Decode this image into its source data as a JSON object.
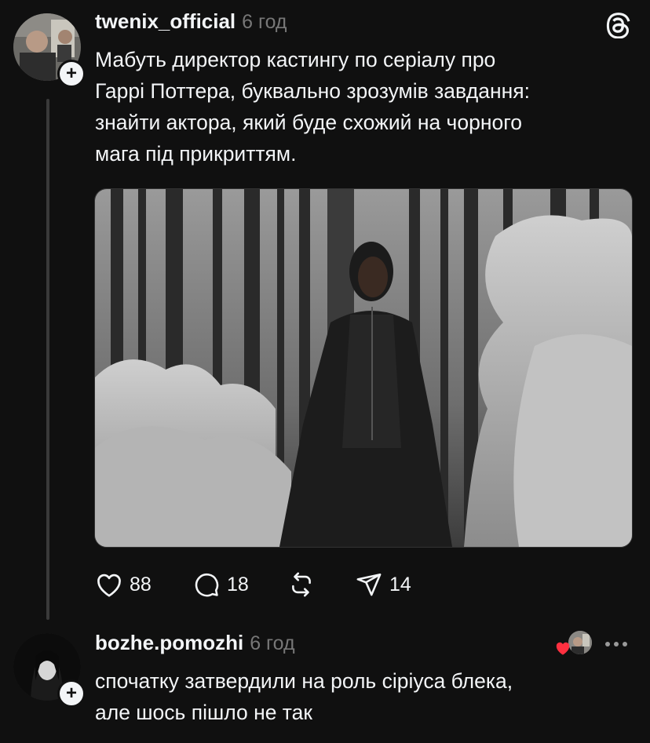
{
  "post": {
    "username": "twenix_official",
    "time": "6 год",
    "text_lines": [
      "Мабуть директор кастингу по серіалу про",
      "Гаррі Поттера, буквально зрозумів завдання:",
      "знайти актора, який буде схожий на чорного",
      "мага під прикриттям."
    ],
    "likes": "88",
    "comments": "18",
    "shares": "14"
  },
  "reply": {
    "username": "bozhe.pomozhi",
    "time": "6 год",
    "text_lines": [
      "спочатку затвердили на роль сіріуса блека,",
      "але шось пішло не так"
    ]
  },
  "icons": {
    "logo": "threads-logo-icon",
    "like": "heart-icon",
    "comment": "comment-icon",
    "repost": "repost-icon",
    "share": "send-icon",
    "more": "more-icon"
  },
  "colors": {
    "background": "#101010",
    "text": "#f3f5f7",
    "secondary": "#777777",
    "liked_heart": "#ff3040"
  }
}
